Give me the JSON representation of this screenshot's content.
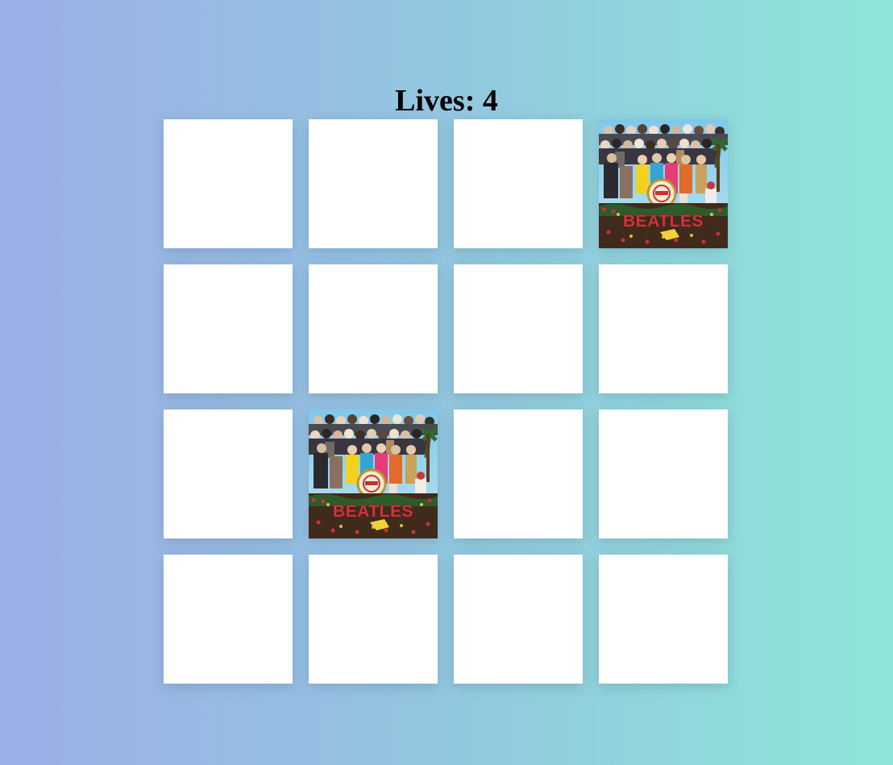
{
  "status": {
    "lives_text": "Lives: 4"
  },
  "board": {
    "columns": 4,
    "rows": 4,
    "cards": [
      {
        "state": "face-down"
      },
      {
        "state": "face-down"
      },
      {
        "state": "face-down"
      },
      {
        "state": "face-up",
        "image": "album-cover-art"
      },
      {
        "state": "face-down"
      },
      {
        "state": "face-down"
      },
      {
        "state": "face-down"
      },
      {
        "state": "face-down"
      },
      {
        "state": "face-down"
      },
      {
        "state": "face-up",
        "image": "album-cover-art"
      },
      {
        "state": "face-down"
      },
      {
        "state": "face-down"
      },
      {
        "state": "face-down"
      },
      {
        "state": "face-down"
      },
      {
        "state": "face-down"
      },
      {
        "state": "face-down"
      }
    ]
  },
  "cover_art": {
    "word": "BEATLES"
  },
  "colors": {
    "card_back": "#ffffff",
    "background_start": "#9caee6",
    "background_end": "#8de6d8"
  }
}
